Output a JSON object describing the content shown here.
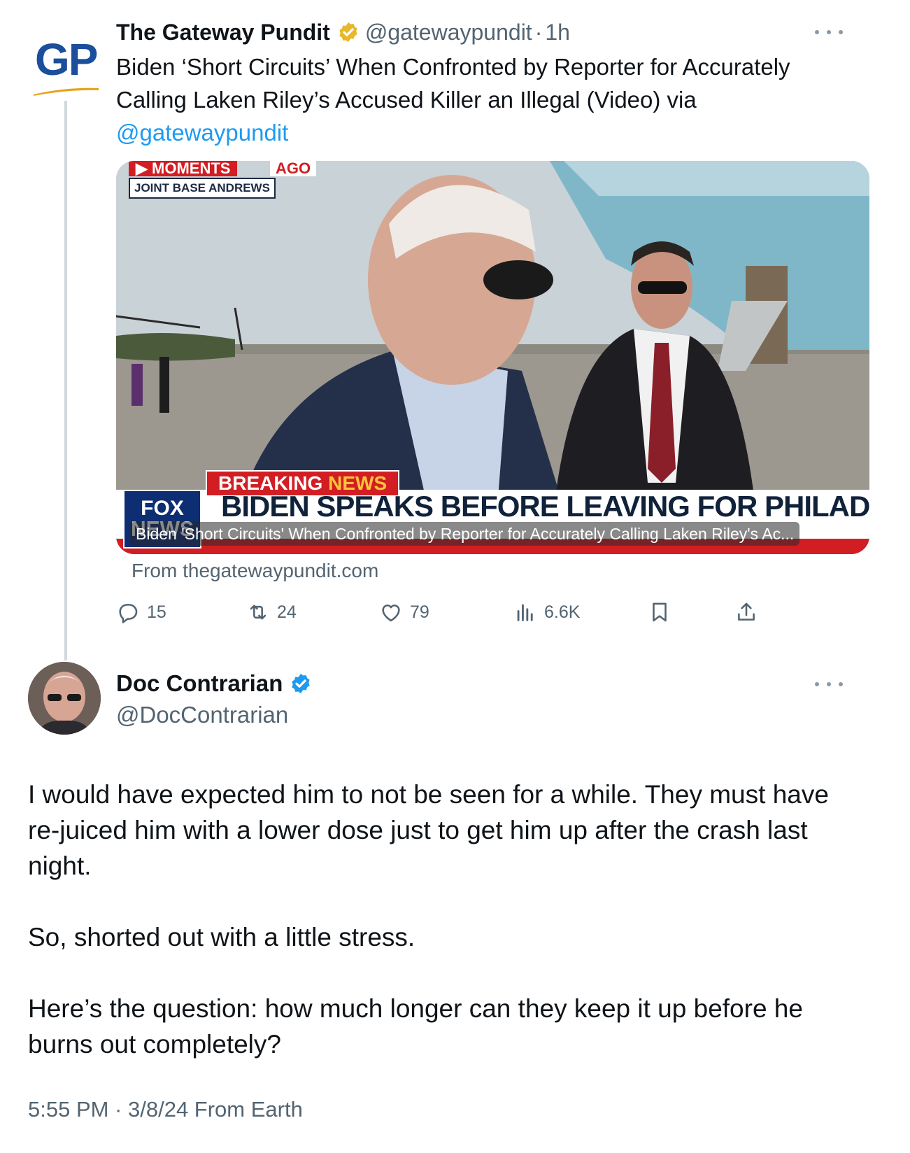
{
  "parent_tweet": {
    "logo_text": "GP",
    "display_name": "The Gateway Pundit",
    "handle": "@gatewaypundit",
    "separator": "·",
    "time": "1h",
    "text": "Biden ‘Short Circuits’ When Confronted by Reporter for Accurately Calling Laken Riley’s Accused Killer an Illegal (Video) via",
    "mention": "@gatewaypundit",
    "card": {
      "caption": "Biden 'Short Circuits' When Confronted by Reporter for Accurately Calling Laken Riley's Ac...",
      "source": "From thegatewaypundit.com",
      "video_overlay": {
        "moments": "▶ MOMENTS",
        "ago": "AGO",
        "location": "JOINT BASE ANDREWS",
        "breaking": "BREAKING",
        "news_word": "NEWS",
        "headline": "BIDEN SPEAKS BEFORE LEAVING FOR PHILADELPHIA",
        "network": "FOX NEWS"
      }
    },
    "actions": {
      "replies": "15",
      "reposts": "24",
      "likes": "79",
      "views": "6.6K"
    }
  },
  "main_tweet": {
    "display_name": "Doc Contrarian",
    "handle": "@DocContrarian",
    "paragraphs": [
      "I would have expected him to not be seen for a while. They must have re-juiced him with a lower dose just to get him up after the crash last night.",
      "So, shorted out with a little stress.",
      "Here’s the question: how much longer can they keep it up before he burns out completely?"
    ],
    "meta": "5:55 PM · 3/8/24 From Earth"
  },
  "colors": {
    "link": "#1d9bf0",
    "secondary_text": "#536471",
    "verified_gold": "#e8b829",
    "verified_blue": "#1d9bf0",
    "gp_blue": "#1b4e9b",
    "gp_gold": "#e8a317"
  },
  "icons": [
    "more-icon",
    "verified-badge-icon",
    "reply-icon",
    "repost-icon",
    "like-icon",
    "views-icon",
    "bookmark-icon",
    "share-icon"
  ]
}
